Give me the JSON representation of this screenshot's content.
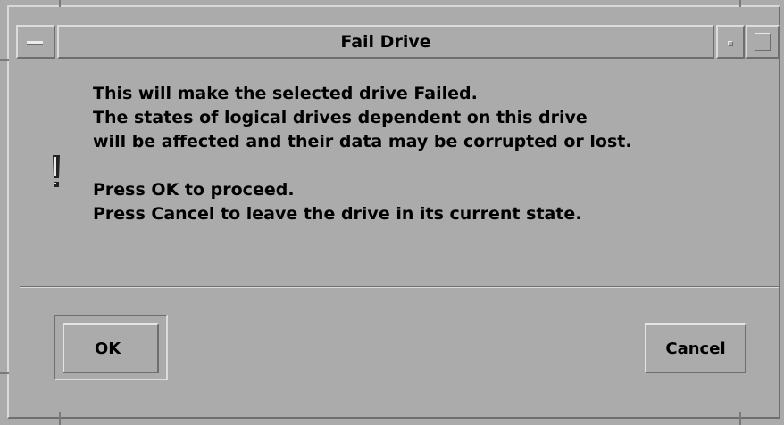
{
  "window": {
    "title": "Fail Drive"
  },
  "icons": {
    "window_menu": "window-menu-icon",
    "minimize": "minimize-icon",
    "maximize": "maximize-icon",
    "warning": "warning-icon"
  },
  "message": {
    "lines": [
      "This will make the selected drive Failed.",
      "The states of logical drives dependent on this drive",
      "will be affected and their data may be corrupted or lost.",
      "",
      "Press OK to proceed.",
      "Press Cancel to leave the drive in its current state."
    ]
  },
  "buttons": {
    "ok_label": "OK",
    "cancel_label": "Cancel"
  },
  "colors": {
    "background": "#ababab",
    "highlight": "#dcdcdc",
    "shadow": "#6e6e6e"
  }
}
